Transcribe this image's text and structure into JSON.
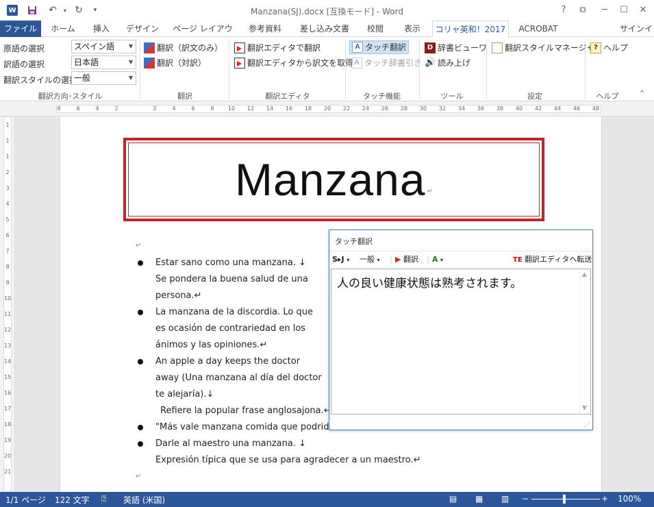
{
  "titlebar": {
    "title": "Manzana(SJ).docx [互換モード] - Word",
    "help": "?",
    "restore_ribbon": "⧉",
    "minimize": "─",
    "maximize": "☐",
    "close": "✕",
    "word_icon": "W",
    "save_icon": "save-icon",
    "undo_icon": "undo-icon",
    "redo_icon": "redo-icon"
  },
  "tabs": [
    {
      "label": "ファイル"
    },
    {
      "label": "ホーム"
    },
    {
      "label": "挿入"
    },
    {
      "label": "デザイン"
    },
    {
      "label": "ページ レイアウト"
    },
    {
      "label": "参考資料"
    },
    {
      "label": "差し込み文書"
    },
    {
      "label": "校閲"
    },
    {
      "label": "表示"
    },
    {
      "label": "コリャ英和！2017"
    },
    {
      "label": "ACROBAT"
    }
  ],
  "signin": "サインイン",
  "ribbon": {
    "direction": {
      "source_label": "原語の選択",
      "source_value": "スペイン語",
      "target_label": "訳語の選択",
      "target_value": "日本語",
      "style_label": "翻訳スタイルの選択",
      "style_value": "一般",
      "group": "翻訳方向･スタイル"
    },
    "translate": {
      "only": "翻訳（訳文のみ）",
      "pair": "翻訳（対訳）",
      "group": "翻訳"
    },
    "editor": {
      "translate_in_editor": "翻訳エディタで翻訳",
      "get_from_editor": "翻訳エディタから訳文を取得",
      "group": "翻訳エディタ"
    },
    "touch": {
      "touch_translate": "タッチ翻訳",
      "touch_dict": "タッチ辞書引き",
      "group": "タッチ機能"
    },
    "tools": {
      "dict_viewer": "辞書ビューワ",
      "read_aloud": "読み上げ",
      "group": "ツール"
    },
    "settings": {
      "style_manager": "翻訳スタイルマネージャ",
      "group": "設定"
    },
    "help": {
      "help": "ヘルプ",
      "group": "ヘルプ"
    }
  },
  "ruler": {
    "h": [
      "8",
      "6",
      "4",
      "2",
      "",
      "2",
      "4",
      "6",
      "8",
      "10",
      "12",
      "14",
      "16",
      "18",
      "20",
      "22",
      "24",
      "26",
      "28",
      "30",
      "32",
      "34",
      "36",
      "38",
      "40",
      "42",
      "44",
      "46",
      "48"
    ],
    "v": [
      "1",
      "1",
      "1",
      "2",
      "3",
      "4",
      "5",
      "6",
      "7",
      "8",
      "9",
      "10",
      "11",
      "12",
      "13",
      "14",
      "15",
      "16",
      "17",
      "18",
      "19",
      "20",
      "21"
    ]
  },
  "document": {
    "title": "Manzana",
    "lines": [
      "Estar sano como una manzana. ↓",
      "Se pondera la buena salud de una",
      "persona.↵",
      "La manzana de la discordia. Lo que",
      "es ocasión de contrariedad en los",
      "ánimos y las opiniones.↵",
      "An apple a day keeps the doctor",
      "away (Una manzana al día del doctor",
      "te alejaría).↓",
      "Refiere la popular frase anglosajona.↵",
      "\"Más vale manzana comida que podrida\".",
      "Darle al maestro una manzana. ↓",
      "Expresión típica que se usa para agradecer a un maestro.↵"
    ]
  },
  "touch_popup": {
    "title": "タッチ翻訳",
    "direction": "S▸J",
    "style": "一般",
    "translate": "翻訳",
    "send_to_editor": "翻訳エディタへ転送",
    "result": "人の良い健康状態は熟考されます。"
  },
  "status": {
    "page": "1/1 ページ",
    "words": "122 文字",
    "language": "英語 (米国)",
    "zoom": "100%",
    "zoom_minus": "−",
    "zoom_plus": "+"
  }
}
